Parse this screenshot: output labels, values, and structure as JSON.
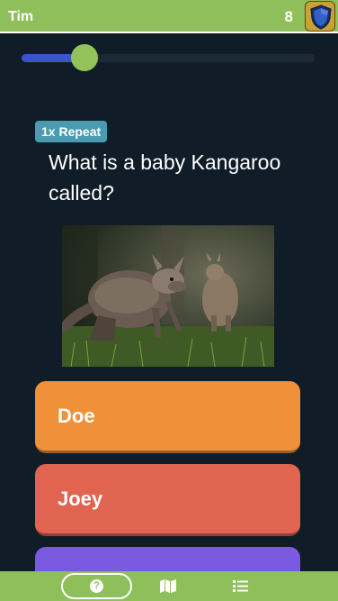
{
  "header": {
    "player_name": "Tim",
    "score": "8"
  },
  "progress": {
    "fraction": 0.215
  },
  "question": {
    "repeat_badge": "1x Repeat",
    "text": "What is a baby Kangaroo called?"
  },
  "answers": [
    {
      "label": "Doe",
      "color": "#f0913a"
    },
    {
      "label": "Joey",
      "color": "#e06450"
    },
    {
      "label": "",
      "color": "#7a5ae0"
    }
  ],
  "footer": {
    "help_icon": "question-circle-icon",
    "map_icon": "map-icon",
    "list_icon": "list-icon"
  },
  "colors": {
    "accent_green": "#8fbf5a",
    "background": "#101c28",
    "progress_blue": "#3a55c9",
    "badge_teal": "#4a9bb0"
  }
}
